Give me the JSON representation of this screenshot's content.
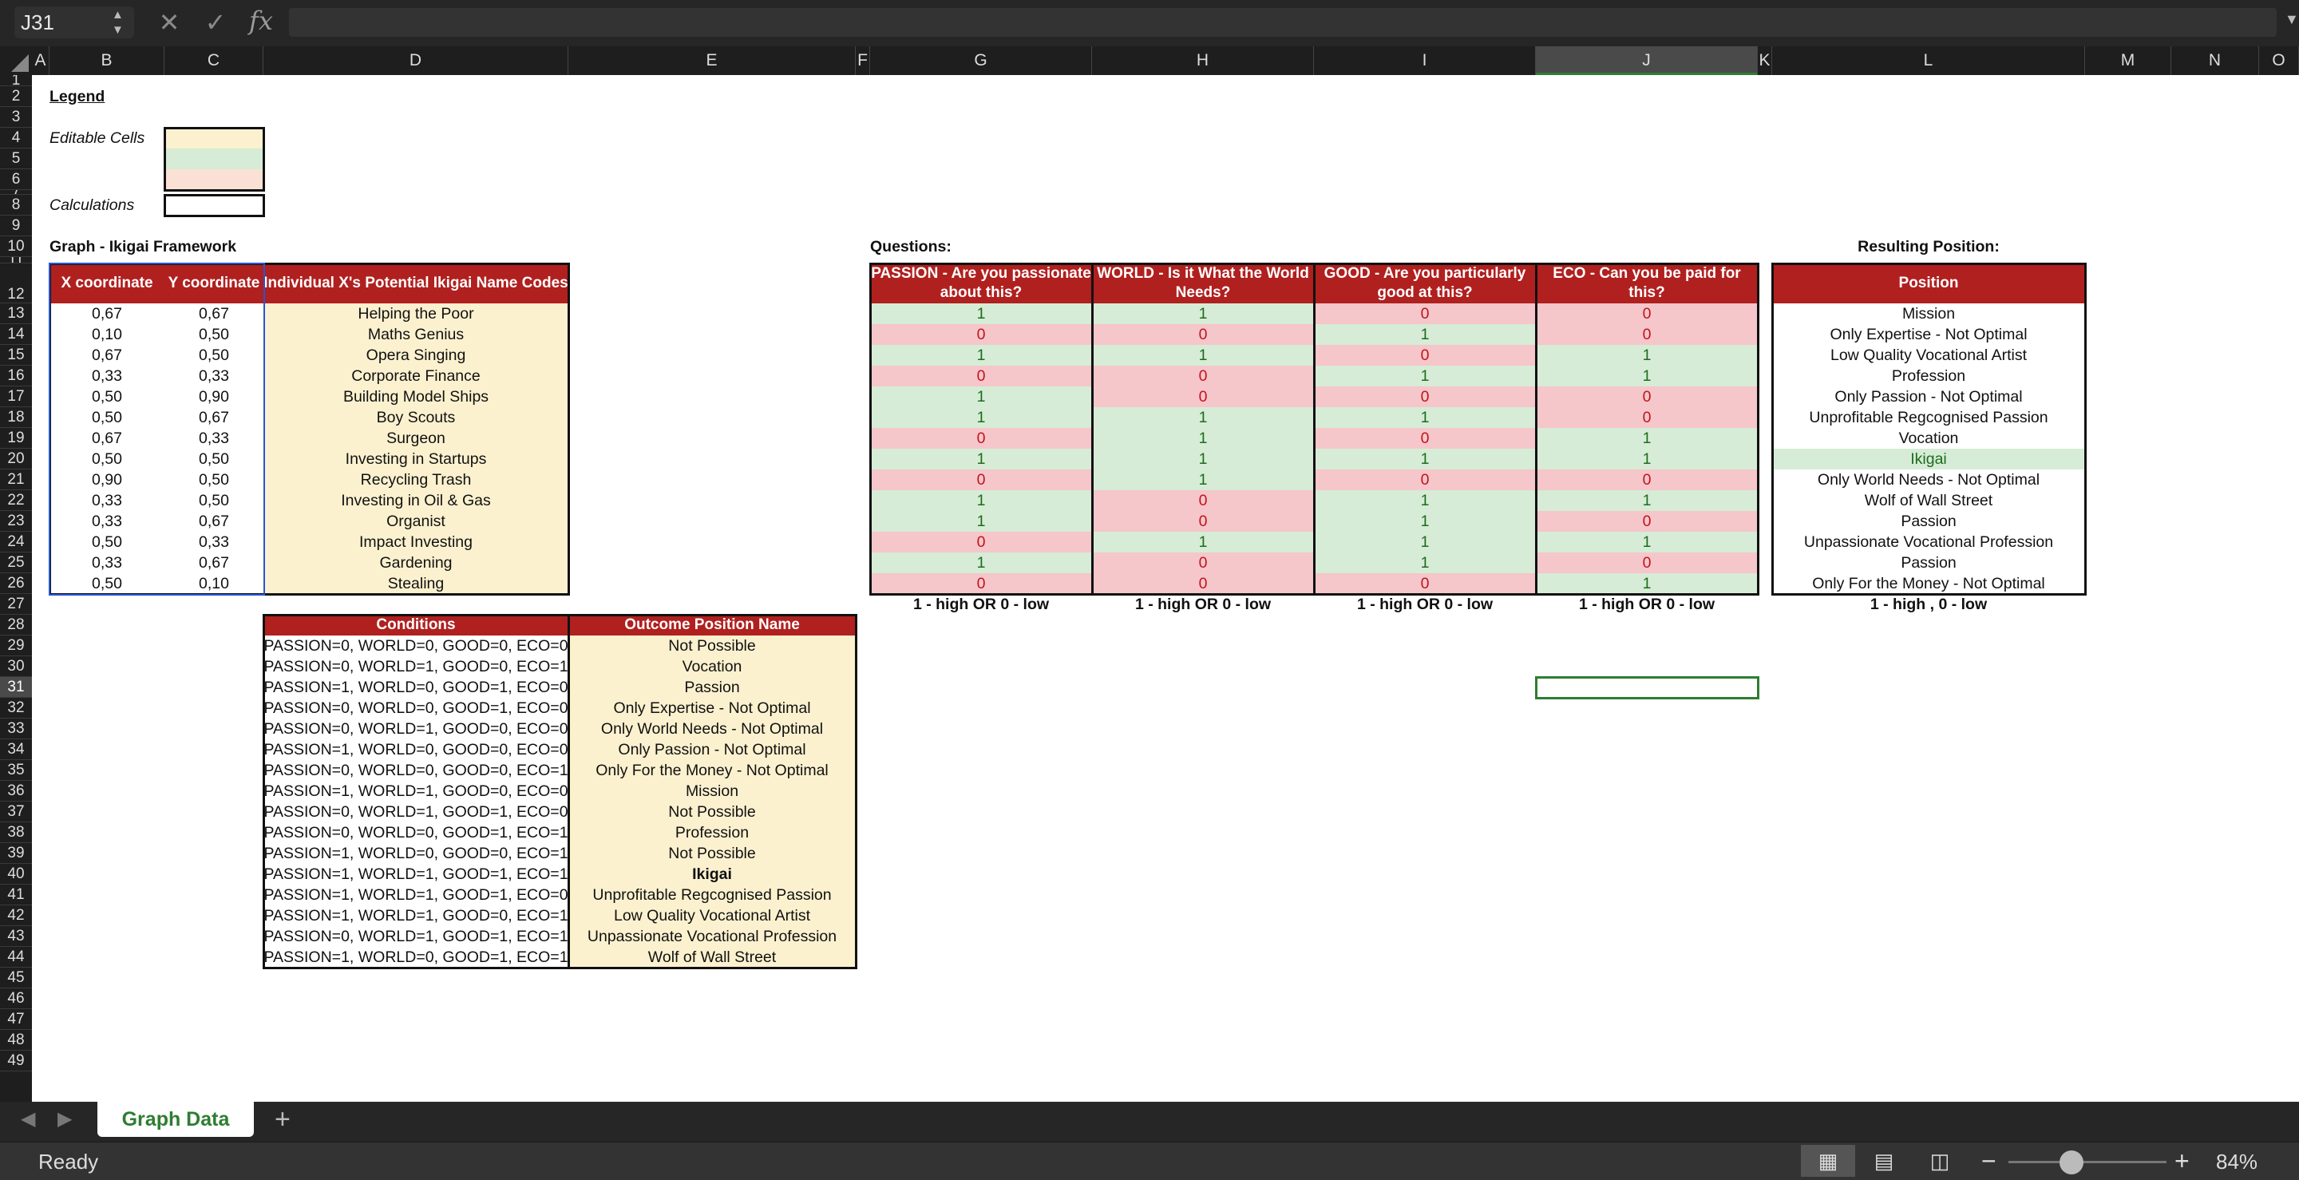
{
  "formula_bar": {
    "name_box": "J31",
    "formula": ""
  },
  "columns": [
    "A",
    "B",
    "C",
    "D",
    "E",
    "F",
    "G",
    "H",
    "I",
    "J",
    "K",
    "L",
    "M",
    "N",
    "O"
  ],
  "selected_column": "J",
  "selected_row": "31",
  "legend": {
    "title": "Legend",
    "editable_label": "Editable Cells",
    "calc_label": "Calculations"
  },
  "graph": {
    "title": "Graph - Ikigai Framework",
    "x_header": "X coordinate",
    "y_header": "Y coordinate",
    "name_header": "Individual X's Potential Ikigai Name Codes",
    "rows": [
      {
        "x": "0,67",
        "y": "0,67",
        "name": "Helping the Poor"
      },
      {
        "x": "0,10",
        "y": "0,50",
        "name": "Maths Genius"
      },
      {
        "x": "0,67",
        "y": "0,50",
        "name": "Opera Singing"
      },
      {
        "x": "0,33",
        "y": "0,33",
        "name": "Corporate Finance"
      },
      {
        "x": "0,50",
        "y": "0,90",
        "name": "Building Model Ships"
      },
      {
        "x": "0,50",
        "y": "0,67",
        "name": "Boy Scouts"
      },
      {
        "x": "0,67",
        "y": "0,33",
        "name": "Surgeon"
      },
      {
        "x": "0,50",
        "y": "0,50",
        "name": "Investing in Startups"
      },
      {
        "x": "0,90",
        "y": "0,50",
        "name": "Recycling Trash"
      },
      {
        "x": "0,33",
        "y": "0,50",
        "name": "Investing in Oil & Gas"
      },
      {
        "x": "0,33",
        "y": "0,67",
        "name": "Organist"
      },
      {
        "x": "0,50",
        "y": "0,33",
        "name": "Impact Investing"
      },
      {
        "x": "0,33",
        "y": "0,67",
        "name": "Gardening"
      },
      {
        "x": "0,50",
        "y": "0,10",
        "name": "Stealing"
      }
    ]
  },
  "questions": {
    "title": "Questions:",
    "headers": [
      "PASSION - Are you passionate about this?",
      "WORLD - Is it What the World Needs?",
      "GOOD - Are you particularly good at this?",
      "ECO - Can you be paid for this?"
    ],
    "values": [
      [
        "1",
        "1",
        "0",
        "0"
      ],
      [
        "0",
        "0",
        "1",
        "0"
      ],
      [
        "1",
        "1",
        "0",
        "1"
      ],
      [
        "0",
        "0",
        "1",
        "1"
      ],
      [
        "1",
        "0",
        "0",
        "0"
      ],
      [
        "1",
        "1",
        "1",
        "0"
      ],
      [
        "0",
        "1",
        "0",
        "1"
      ],
      [
        "1",
        "1",
        "1",
        "1"
      ],
      [
        "0",
        "1",
        "0",
        "0"
      ],
      [
        "1",
        "0",
        "1",
        "1"
      ],
      [
        "1",
        "0",
        "1",
        "0"
      ],
      [
        "0",
        "1",
        "1",
        "1"
      ],
      [
        "1",
        "0",
        "1",
        "0"
      ],
      [
        "0",
        "0",
        "0",
        "1"
      ]
    ],
    "footer": "1 - high  OR  0 - low"
  },
  "result": {
    "title": "Resulting Position:",
    "header": "Position",
    "values": [
      "Mission",
      "Only Expertise - Not Optimal",
      "Low Quality Vocational Artist",
      "Profession",
      "Only Passion - Not Optimal",
      "Unprofitable Regcognised Passion",
      "Vocation",
      "Ikigai",
      "Only World Needs - Not Optimal",
      "Wolf of Wall Street",
      "Passion",
      "Unpassionate Vocational Profession",
      "Passion",
      "Only For the Money - Not Optimal"
    ],
    "footer": "1 - high , 0 - low"
  },
  "conditions": {
    "headers": [
      "Conditions",
      "Outcome Position Name"
    ],
    "rows": [
      [
        "PASSION=0, WORLD=0, GOOD=0, ECO=0",
        "Not Possible"
      ],
      [
        "PASSION=0, WORLD=1, GOOD=0, ECO=1",
        "Vocation"
      ],
      [
        "PASSION=1, WORLD=0, GOOD=1, ECO=0",
        "Passion"
      ],
      [
        "PASSION=0, WORLD=0, GOOD=1, ECO=0",
        "Only Expertise - Not Optimal"
      ],
      [
        "PASSION=0, WORLD=1, GOOD=0, ECO=0",
        "Only World Needs - Not Optimal"
      ],
      [
        "PASSION=1, WORLD=0, GOOD=0, ECO=0",
        "Only Passion - Not Optimal"
      ],
      [
        "PASSION=0, WORLD=0, GOOD=0, ECO=1",
        "Only For the Money - Not Optimal"
      ],
      [
        "PASSION=1, WORLD=1, GOOD=0, ECO=0",
        "Mission"
      ],
      [
        "PASSION=0, WORLD=1, GOOD=1, ECO=0",
        "Not Possible"
      ],
      [
        "PASSION=0, WORLD=0, GOOD=1, ECO=1",
        "Profession"
      ],
      [
        "PASSION=1, WORLD=0, GOOD=0, ECO=1",
        "Not Possible"
      ],
      [
        "PASSION=1, WORLD=1, GOOD=1, ECO=1",
        "Ikigai"
      ],
      [
        "PASSION=1, WORLD=1, GOOD=1, ECO=0",
        "Unprofitable Regcognised Passion"
      ],
      [
        "PASSION=1, WORLD=1, GOOD=0, ECO=1",
        "Low Quality Vocational Artist"
      ],
      [
        "PASSION=0, WORLD=1, GOOD=1, ECO=1",
        "Unpassionate Vocational Profession"
      ],
      [
        "PASSION=1, WORLD=0, GOOD=1, ECO=1",
        "Wolf of Wall Street"
      ]
    ]
  },
  "sheet_tabs": [
    {
      "label": "Graph Data",
      "active": true
    }
  ],
  "status": {
    "text": "Ready",
    "zoom": "84%"
  },
  "colors": {
    "header_red": "#b0201f",
    "editable_yellow": "#fcf1cf",
    "editable_green": "#d6ecd6",
    "editable_pink": "#f5c6ca",
    "accent_green": "#2e7d32"
  }
}
